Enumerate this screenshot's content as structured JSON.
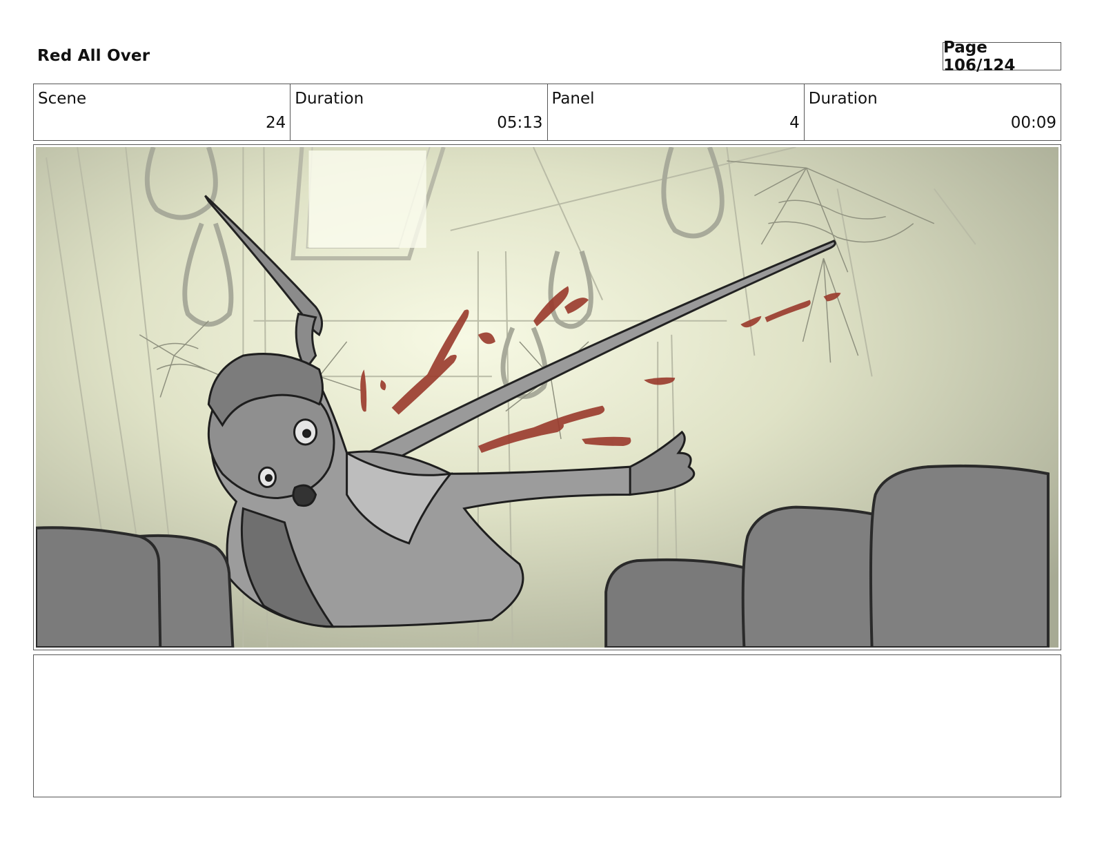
{
  "header": {
    "title": "Red All Over",
    "page": "Page 106/124"
  },
  "info": {
    "scene_label": "Scene",
    "scene_value": "24",
    "scene_duration_label": "Duration",
    "scene_duration_value": "05:13",
    "panel_label": "Panel",
    "panel_value": "4",
    "panel_duration_label": "Duration",
    "panel_duration_value": "00:09"
  },
  "panel": {
    "accent_blood": "#9a3a2c",
    "background_glow": "#f4f6dc",
    "background_edge": "#a3a690",
    "seat_fill": "#7b7b7b"
  },
  "notes": {
    "text": ""
  }
}
